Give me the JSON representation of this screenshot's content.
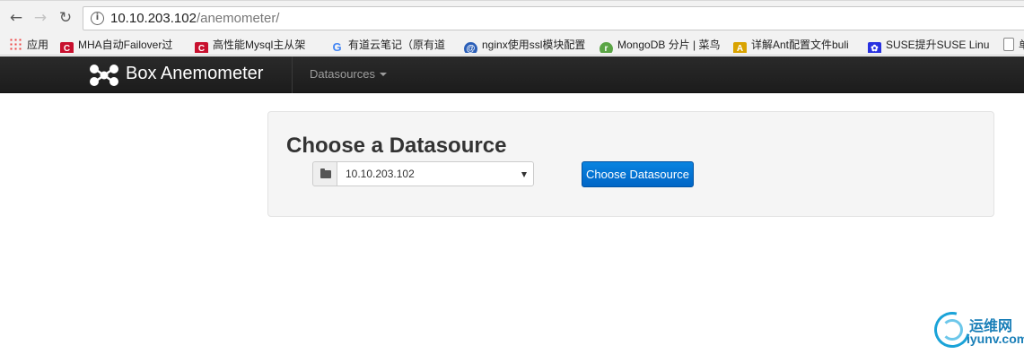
{
  "browser": {
    "url_host": "10.10.203.102",
    "url_path": "/anemometer/",
    "back_icon": "arrow-left-icon",
    "forward_icon": "arrow-right-icon",
    "reload_icon": "reload-icon"
  },
  "bookmarks": [
    {
      "label": "应用",
      "icon": "apps-grid-icon"
    },
    {
      "label": "MHA自动Failover过",
      "icon": "bookmark-red-icon"
    },
    {
      "label": "高性能Mysql主从架",
      "icon": "bookmark-red-icon"
    },
    {
      "label": "有道云笔记（原有道",
      "icon": "google-icon"
    },
    {
      "label": "nginx使用ssl模块配置",
      "icon": "globe-icon"
    },
    {
      "label": "MongoDB 分片 | 菜鸟",
      "icon": "runoob-icon"
    },
    {
      "label": "详解Ant配置文件buli",
      "icon": "ant-icon"
    },
    {
      "label": "SUSE提升SUSE Linu",
      "icon": "paw-icon"
    },
    {
      "label": "单",
      "icon": "page-icon"
    }
  ],
  "navbar": {
    "brand": "Box Anemometer",
    "datasources_menu": "Datasources"
  },
  "main": {
    "title": "Choose a Datasource",
    "select_value": "10.10.203.102",
    "button_label": "Choose Datasource"
  },
  "watermark": {
    "cn": "运维网",
    "en": "iyunv.com"
  },
  "colors": {
    "navbar_bg": "#222222",
    "primary_button": "#0065c6",
    "card_bg": "#f5f5f5"
  }
}
